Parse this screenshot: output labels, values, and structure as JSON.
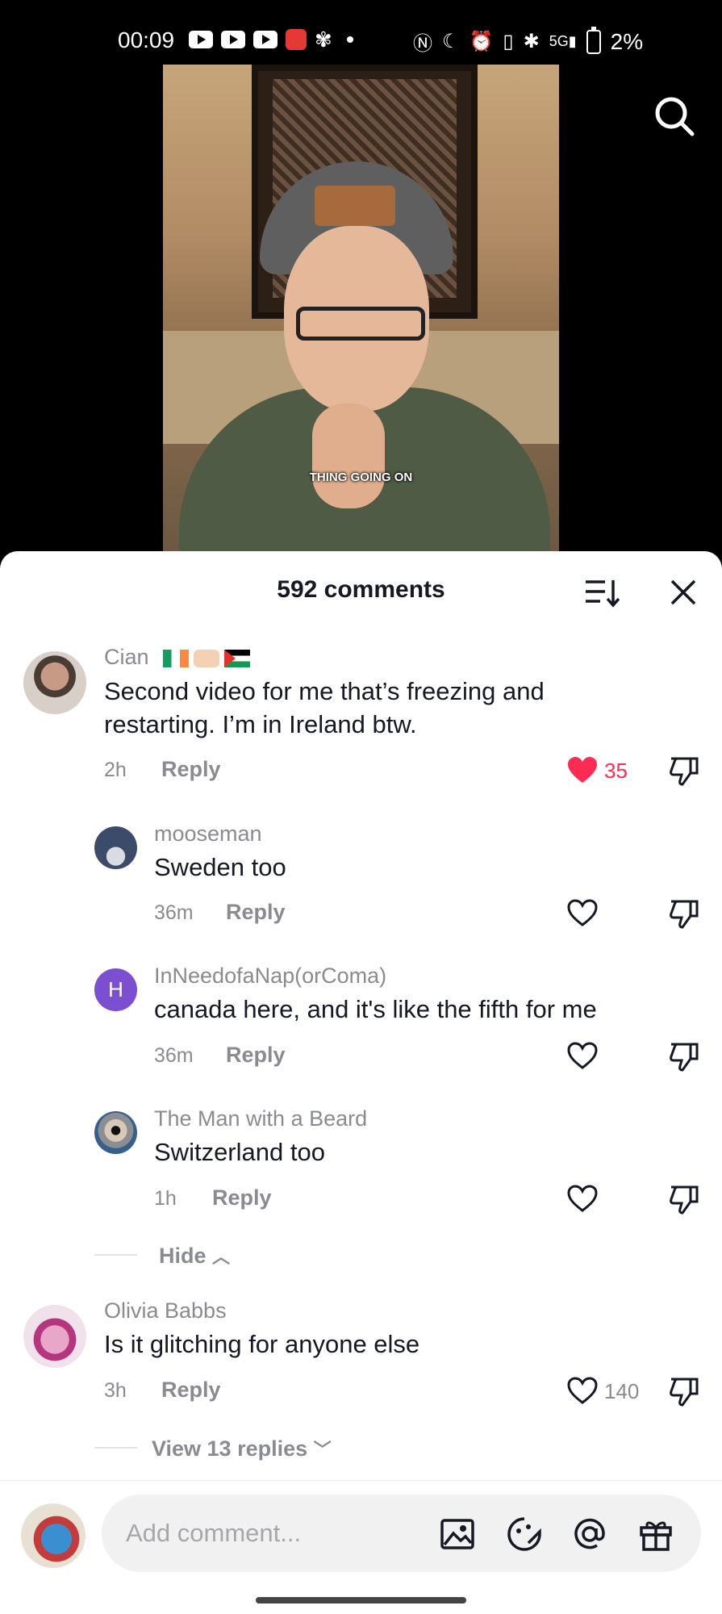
{
  "status_bar": {
    "time": "00:09",
    "battery": "2%",
    "network": "5G",
    "left_icons": [
      "youtube-icon",
      "youtube-icon",
      "youtube-icon",
      "app-icon",
      "ghost-icon",
      "dot-icon"
    ],
    "right_icons": [
      "nfc-icon",
      "moon-icon",
      "alarm-icon",
      "vibrate-icon",
      "bluetooth-icon",
      "volte-icon",
      "signal-icon",
      "battery-icon"
    ]
  },
  "video": {
    "caption": "THING GOING ON"
  },
  "comments_sheet": {
    "title": "592 comments",
    "comments": [
      {
        "username": "Cian",
        "text_line1": "Second video for me that’s freezing and",
        "text_line2": "restarting. I’m in Ireland btw.",
        "time": "2h",
        "reply_label": "Reply",
        "likes": "35",
        "liked": true
      },
      {
        "username": "mooseman",
        "text": "Sweden too",
        "time": "36m",
        "reply_label": "Reply"
      },
      {
        "username": "InNeedofaNap(orComa)",
        "avatar_letter": "H",
        "text": "canada here, and it's like the fifth for me",
        "time": "36m",
        "reply_label": "Reply"
      },
      {
        "username": "The Man with a Beard",
        "text": "Switzerland too",
        "time": "1h",
        "reply_label": "Reply"
      },
      {
        "username": "Olivia Babbs",
        "text": "Is it glitching for anyone else",
        "time": "3h",
        "reply_label": "Reply",
        "likes": "140"
      }
    ],
    "hide_label": "Hide",
    "view_replies_label": "View 13 replies"
  },
  "composer": {
    "placeholder": "Add comment..."
  },
  "colors": {
    "accent_like": "#fe2c55",
    "avatar_letter_bg": "#7b4fd0",
    "text_primary": "#161823",
    "text_secondary": "#8a8b91"
  }
}
